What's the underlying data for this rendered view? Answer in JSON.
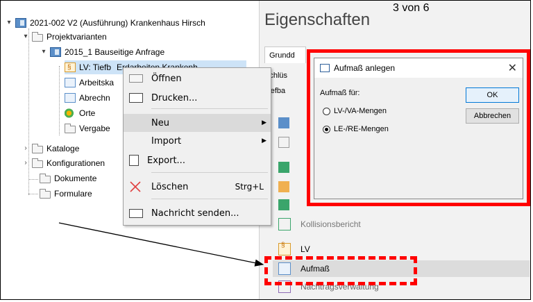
{
  "tree": {
    "root": "2021-002 V2 (Ausführung) Krankenhaus Hirsch",
    "projektvarianten": "Projektvarianten",
    "variante": "2015_1 Bauseitige Anfrage",
    "lv": "LV: Tiefb",
    "lv_tail": "Erdarbeiten Krankenh",
    "arbeitskalk": "Arbeitska",
    "abrechnung": "Abrechn",
    "orte": "Orte",
    "vergabe": "Vergabe",
    "kataloge": "Kataloge",
    "konfigurationen": "Konfigurationen",
    "dokumente": "Dokumente",
    "formulare": "Formulare"
  },
  "panel": {
    "title": "Eigenschaften",
    "page_count": "3 von 6",
    "tab": "Grundd",
    "field1": "Schlüs",
    "field2": "Tiefba",
    "ribbon_items": [
      {
        "label": "Kollisionsbericht"
      },
      {
        "label": "LV"
      },
      {
        "label": "Aufmaß"
      },
      {
        "label": "Nachtragsverwaltung"
      }
    ]
  },
  "context_menu": {
    "items": [
      {
        "label": "Öffnen"
      },
      {
        "label": "Drucken..."
      },
      {
        "label": "Neu"
      },
      {
        "label": "Import"
      },
      {
        "label": "Export..."
      },
      {
        "label": "Löschen",
        "shortcut": "Strg+L"
      },
      {
        "label": "Nachricht senden..."
      }
    ]
  },
  "dialog": {
    "title": "Aufmaß anlegen",
    "label": "Aufmaß für:",
    "options": [
      "LV-/VA-Mengen",
      "LE-/RE-Mengen"
    ],
    "selected": "LE-/RE-Mengen",
    "ok": "OK",
    "cancel": "Abbrechen",
    "close": "✕"
  },
  "colors": {
    "highlight_red": "#ff0000",
    "selection": "#cde3f7",
    "accent_blue": "#0078d7"
  }
}
